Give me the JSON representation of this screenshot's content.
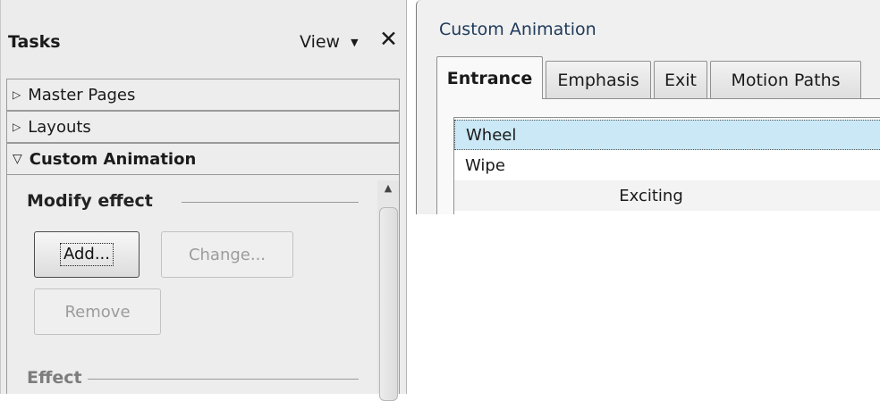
{
  "tasks_pane": {
    "title": "Tasks",
    "view_label": "View",
    "view_caret": "▼",
    "close_glyph": "✕",
    "decks": [
      {
        "label": "Master Pages",
        "expanded": false,
        "glyph": "▷"
      },
      {
        "label": "Layouts",
        "expanded": false,
        "glyph": "▷"
      },
      {
        "label": "Custom Animation",
        "expanded": true,
        "glyph": "▽"
      }
    ],
    "custom_animation": {
      "modify_effect_heading": "Modify effect",
      "add_button": "Add...",
      "change_button": "Change...",
      "remove_button": "Remove",
      "effect_heading": "Effect",
      "scroll_up_glyph": "▲"
    }
  },
  "dialog": {
    "title": "Custom Animation",
    "tabs": [
      {
        "label": "Entrance",
        "active": true
      },
      {
        "label": "Emphasis",
        "active": false
      },
      {
        "label": "Exit",
        "active": false
      },
      {
        "label": "Motion Paths",
        "active": false
      }
    ],
    "effects": [
      {
        "label": "Wheel",
        "selected": true
      },
      {
        "label": "Wipe",
        "selected": false
      }
    ],
    "category_header": "Exciting"
  },
  "colors": {
    "selection": "#cbe8f6",
    "pane_background": "#ececec",
    "disabled_text": "#9c9c9c"
  }
}
